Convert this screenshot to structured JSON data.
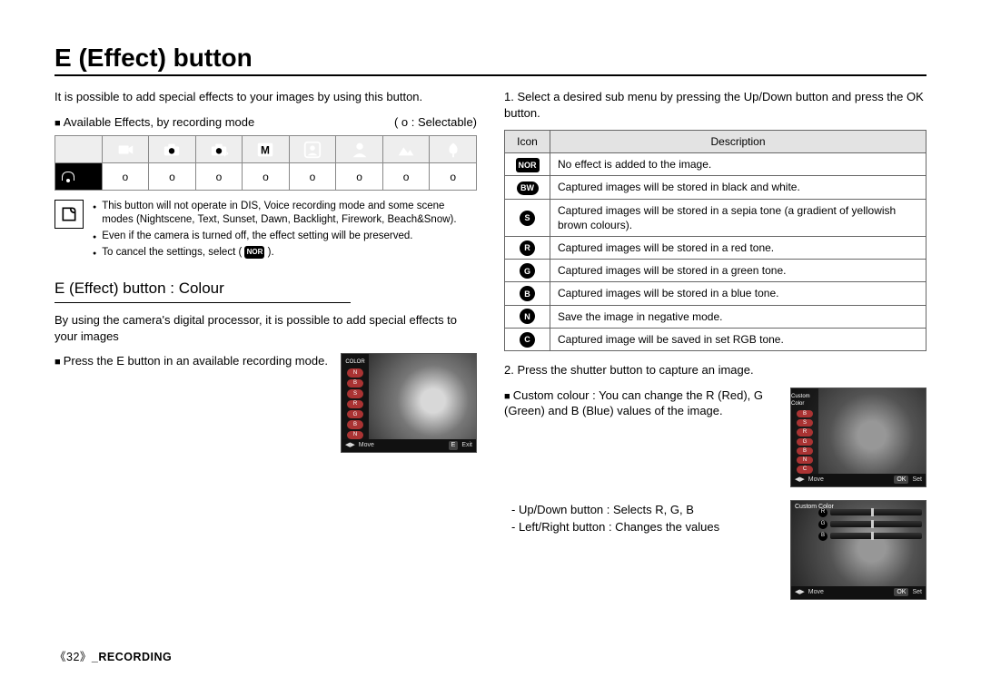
{
  "title": "E (Effect) button",
  "intro": "It is possible to add special effects to your images by using this button.",
  "available_effects_label": "Available Effects, by recording mode",
  "selectable_legend": "( o : Selectable)",
  "modes_row_values": [
    "o",
    "o",
    "o",
    "o",
    "o",
    "o",
    "o",
    "o"
  ],
  "note": {
    "items": [
      "This button will not operate in DIS, Voice recording mode and some scene modes (Nightscene, Text, Sunset, Dawn, Backlight, Firework, Beach&Snow).",
      "Even if the camera is turned off, the effect setting will be preserved.",
      "To cancel the settings, select ( "
    ],
    "nor_label": "NOR",
    "note3_tail": " )."
  },
  "colour": {
    "heading": "E (Effect) button : Colour",
    "para": "By using the camera's digital processor, it is possible to add special effects to your images",
    "press_e": "Press the E button in an available recording mode.",
    "lcd1": {
      "sidebar_title": "COLOR",
      "move": "Move",
      "exit_key": "E",
      "exit": "Exit",
      "arrows": "◀▶"
    }
  },
  "right": {
    "step1": "1. Select a desired sub menu by pressing the Up/Down button and press the OK button.",
    "table_headers": {
      "icon": "Icon",
      "desc": "Description"
    },
    "rows": [
      {
        "icon_type": "rect",
        "icon_text": "NOR",
        "desc": "No effect is added to the image."
      },
      {
        "icon_type": "pill",
        "icon_text": "BW",
        "desc": "Captured images will be stored in black and white."
      },
      {
        "icon_type": "circ",
        "icon_text": "S",
        "desc": "Captured images will be stored in a sepia tone (a gradient of yellowish brown colours)."
      },
      {
        "icon_type": "circ",
        "icon_text": "R",
        "desc": "Captured images will be stored in a red tone."
      },
      {
        "icon_type": "circ",
        "icon_text": "G",
        "desc": "Captured images will be stored in a green tone."
      },
      {
        "icon_type": "circ",
        "icon_text": "B",
        "desc": "Captured images will be stored in a blue tone."
      },
      {
        "icon_type": "circ",
        "icon_text": "N",
        "desc": "Save the image in negative mode."
      },
      {
        "icon_type": "circ",
        "icon_text": "C",
        "desc": "Captured image will be saved in set RGB tone."
      }
    ],
    "step2": "2. Press the shutter button to capture an image.",
    "custom_label": "Custom colour : You can change the R (Red), G (Green) and B (Blue) values of the image.",
    "updown": "- Up/Down button : Selects R, G, B",
    "leftright": "- Left/Right button : Changes the values",
    "lcd2": {
      "title": "Custom Color",
      "labels": [
        "R",
        "G",
        "B"
      ],
      "move": "Move",
      "set_key": "OK",
      "set": "Set",
      "arrows1": "▲▼",
      "arrows2": "◀▶"
    }
  },
  "footer": {
    "page": "《32》",
    "section": "_RECORDING"
  }
}
